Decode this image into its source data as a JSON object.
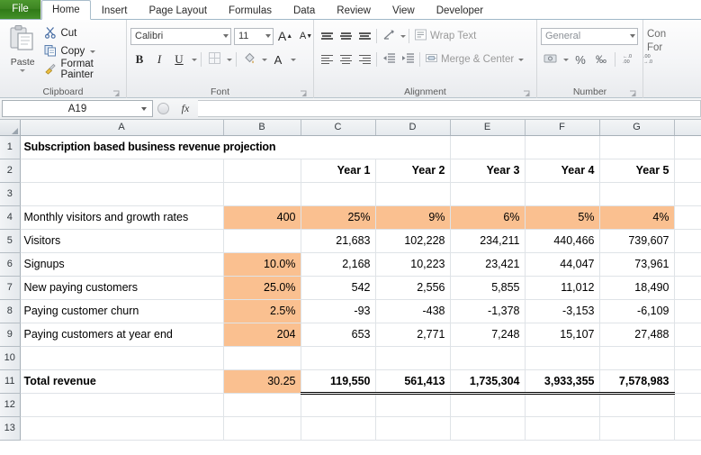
{
  "window": {
    "app": "Microsoft Excel"
  },
  "ribbon": {
    "tabs": [
      {
        "label": "File",
        "active": false,
        "is_file": true
      },
      {
        "label": "Home",
        "active": true
      },
      {
        "label": "Insert",
        "active": false
      },
      {
        "label": "Page Layout",
        "active": false
      },
      {
        "label": "Formulas",
        "active": false
      },
      {
        "label": "Data",
        "active": false
      },
      {
        "label": "Review",
        "active": false
      },
      {
        "label": "View",
        "active": false
      },
      {
        "label": "Developer",
        "active": false
      }
    ],
    "clipboard": {
      "group_label": "Clipboard",
      "paste_label": "Paste",
      "cut_label": "Cut",
      "copy_label": "Copy",
      "format_painter_label": "Format Painter"
    },
    "font": {
      "group_label": "Font",
      "font_name": "Calibri",
      "font_size": "11",
      "grow_font": "A",
      "shrink_font": "A",
      "bold": "B",
      "italic": "I",
      "underline": "U"
    },
    "alignment": {
      "group_label": "Alignment",
      "wrap_text_label": "Wrap Text",
      "merge_center_label": "Merge & Center"
    },
    "number": {
      "group_label": "Number",
      "format_value": "General",
      "percent_symbol": "%",
      "comma_symbol": "‰"
    },
    "styles": {
      "line1": "Con",
      "line2": "For"
    }
  },
  "formula_bar": {
    "name_box_value": "A19",
    "fx_label": "fx",
    "formula_value": ""
  },
  "sheet": {
    "column_headers": [
      "A",
      "B",
      "C",
      "D",
      "E",
      "F",
      "G"
    ],
    "row_numbers": [
      "1",
      "2",
      "3",
      "4",
      "5",
      "6",
      "7",
      "8",
      "9",
      "10",
      "11",
      "12",
      "13"
    ],
    "title": "Subscription based business revenue projection",
    "year_headers": [
      "Year 1",
      "Year 2",
      "Year 3",
      "Year 4",
      "Year 5"
    ],
    "rows": [
      {
        "label": "Monthly visitors and growth rates",
        "b": "400",
        "values": [
          "25%",
          "9%",
          "6%",
          "5%",
          "4%"
        ],
        "b_filled": true,
        "values_filled": true
      },
      {
        "label": "Visitors",
        "b": "",
        "values": [
          "21,683",
          "102,228",
          "234,211",
          "440,466",
          "739,607"
        ],
        "b_filled": false,
        "values_filled": false
      },
      {
        "label": "Signups",
        "b": "10.0%",
        "values": [
          "2,168",
          "10,223",
          "23,421",
          "44,047",
          "73,961"
        ],
        "b_filled": true,
        "values_filled": false
      },
      {
        "label": "New paying customers",
        "b": "25.0%",
        "values": [
          "542",
          "2,556",
          "5,855",
          "11,012",
          "18,490"
        ],
        "b_filled": true,
        "values_filled": false
      },
      {
        "label": "Paying  customer churn",
        "b": "2.5%",
        "values": [
          "-93",
          "-438",
          "-1,378",
          "-3,153",
          "-6,109"
        ],
        "b_filled": true,
        "values_filled": false
      },
      {
        "label": "Paying customers at year end",
        "b": "204",
        "values": [
          "653",
          "2,771",
          "7,248",
          "15,107",
          "27,488"
        ],
        "b_filled": true,
        "values_filled": false
      }
    ],
    "total_row": {
      "label": "Total revenue",
      "b": "30.25",
      "values": [
        "119,550",
        "561,413",
        "1,735,304",
        "3,933,355",
        "7,578,983"
      ],
      "b_filled": true
    },
    "selected_cell": "A19"
  },
  "colors": {
    "accent_green": "#3e8523",
    "fill_orange": "#fac090",
    "grid_line": "#dfe3e7",
    "header_bg": "#e6eaee"
  }
}
